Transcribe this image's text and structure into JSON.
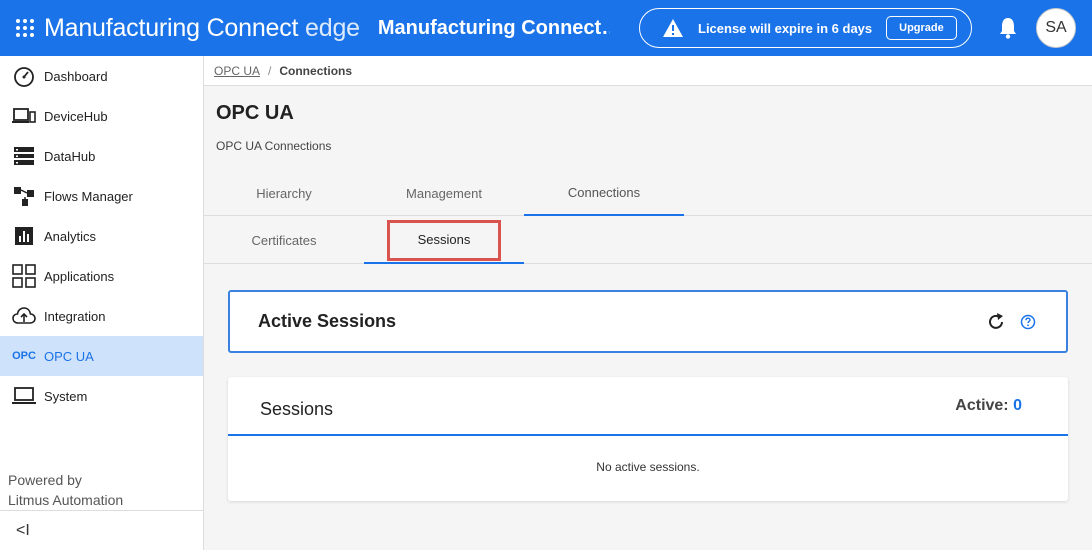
{
  "topbar": {
    "brand_main": "Manufacturing Connect",
    "brand_edge": "edge",
    "app_title": "Manufacturing Connect…",
    "license_text": "License will expire in 6 days",
    "upgrade_label": "Upgrade",
    "avatar_initials": "SA",
    "accent_color": "#1a73e8"
  },
  "sidebar": {
    "items": [
      {
        "label": "Dashboard",
        "icon": "speedometer-icon"
      },
      {
        "label": "DeviceHub",
        "icon": "devices-icon"
      },
      {
        "label": "DataHub",
        "icon": "server-icon"
      },
      {
        "label": "Flows Manager",
        "icon": "flow-icon"
      },
      {
        "label": "Analytics",
        "icon": "analytics-icon"
      },
      {
        "label": "Applications",
        "icon": "apps-grid-icon"
      },
      {
        "label": "Integration",
        "icon": "cloud-upload-icon"
      },
      {
        "label": "OPC UA",
        "icon": "opc-icon",
        "icon_text": "OPC",
        "active": true
      },
      {
        "label": "System",
        "icon": "laptop-icon"
      }
    ],
    "powered_line1": "Powered by",
    "powered_line2": "Litmus Automation",
    "collapse_glyph": "<I"
  },
  "breadcrumb": {
    "parent": "OPC UA",
    "separator": "/",
    "current": "Connections"
  },
  "page": {
    "title": "OPC UA",
    "subtitle": "OPC UA Connections"
  },
  "tabs_primary": [
    {
      "label": "Hierarchy",
      "active": false
    },
    {
      "label": "Management",
      "active": false
    },
    {
      "label": "Connections",
      "active": true
    }
  ],
  "tabs_secondary": [
    {
      "label": "Certificates",
      "active": false
    },
    {
      "label": "Sessions",
      "active": true
    }
  ],
  "active_sessions_card": {
    "title": "Active Sessions"
  },
  "sessions_card": {
    "title": "Sessions",
    "active_label": "Active:",
    "active_count": "0",
    "empty_message": "No active sessions."
  }
}
